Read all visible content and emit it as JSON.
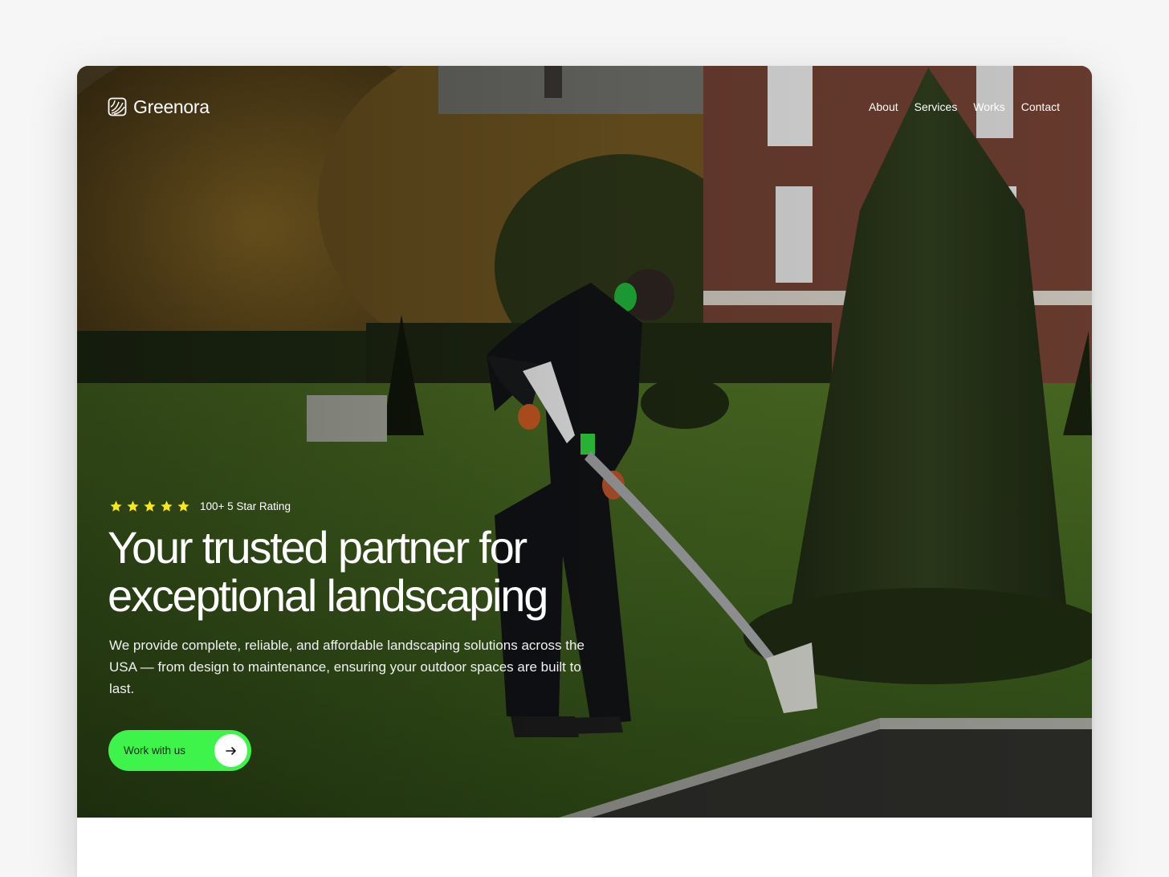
{
  "brand": {
    "name": "Greenora",
    "logo_icon": "leaf-lines-icon"
  },
  "nav": {
    "items": [
      "About",
      "Services",
      "Works",
      "Contact"
    ]
  },
  "hero": {
    "rating": {
      "stars": 5,
      "text": "100+ 5 Star Rating",
      "star_color": "#f5e81b"
    },
    "headline_line1": "Your trusted partner for",
    "headline_line2": "exceptional landscaping",
    "description": "We provide complete, reliable, and affordable landscaping solutions across the USA — from design to maintenance, ensuring your outdoor spaces are built to last.",
    "cta": {
      "label": "Work with us",
      "icon": "arrow-right-icon",
      "color": "#3ef44a"
    }
  }
}
